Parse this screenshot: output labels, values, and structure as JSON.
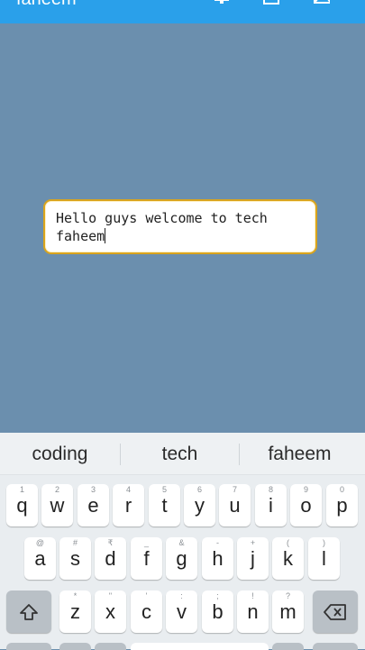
{
  "appbar": {
    "title": "faheem",
    "icons": [
      "monitor-icon",
      "square-icon",
      "image-icon"
    ],
    "color": "#2aa0ea"
  },
  "editor": {
    "text_line1": "Hello guys welcome to tech",
    "text_line2": "faheem",
    "border_color": "#d9a41d",
    "background": "#6b8fae"
  },
  "keyboard": {
    "suggestions": [
      "coding",
      "tech",
      "faheem"
    ],
    "row1": [
      {
        "key": "q",
        "hint": "1"
      },
      {
        "key": "w",
        "hint": "2"
      },
      {
        "key": "e",
        "hint": "3"
      },
      {
        "key": "r",
        "hint": "4"
      },
      {
        "key": "t",
        "hint": "5"
      },
      {
        "key": "y",
        "hint": "6"
      },
      {
        "key": "u",
        "hint": "7"
      },
      {
        "key": "i",
        "hint": "8"
      },
      {
        "key": "o",
        "hint": "9"
      },
      {
        "key": "p",
        "hint": "0"
      }
    ],
    "row2": [
      {
        "key": "a",
        "hint": "@"
      },
      {
        "key": "s",
        "hint": "#"
      },
      {
        "key": "d",
        "hint": "₹"
      },
      {
        "key": "f",
        "hint": "_"
      },
      {
        "key": "g",
        "hint": "&"
      },
      {
        "key": "h",
        "hint": "-"
      },
      {
        "key": "j",
        "hint": "+"
      },
      {
        "key": "k",
        "hint": "("
      },
      {
        "key": "l",
        "hint": ")"
      }
    ],
    "row3": [
      {
        "key": "z",
        "hint": "*"
      },
      {
        "key": "x",
        "hint": "\""
      },
      {
        "key": "c",
        "hint": "'"
      },
      {
        "key": "v",
        "hint": ":"
      },
      {
        "key": "b",
        "hint": ";"
      },
      {
        "key": "n",
        "hint": "!"
      },
      {
        "key": "m",
        "hint": "?"
      }
    ],
    "shift_icon": "shift-icon",
    "backspace_icon": "backspace-icon"
  }
}
